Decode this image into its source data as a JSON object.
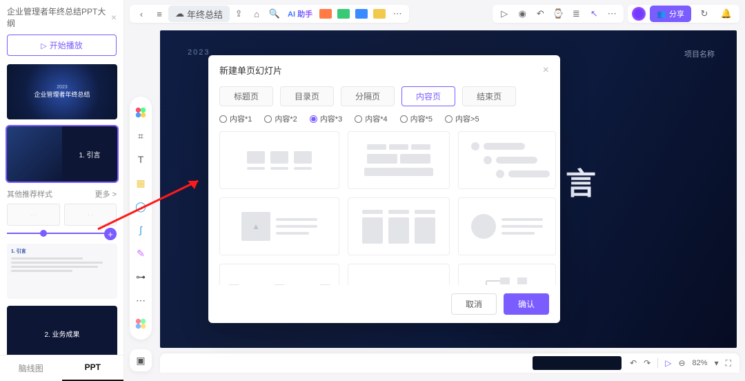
{
  "doc": {
    "title": "企业管理者年终总结PPT大纲",
    "close": "×"
  },
  "play": {
    "icon": "▷",
    "label": "开始播放"
  },
  "slides": {
    "sec1": "1. 引言",
    "other_styles": "其他推荐样式",
    "more": "更多 >",
    "outline_hd": "1. 引言",
    "sec2": "2. 业务成果",
    "cover_title": "企业管理者年终总结"
  },
  "bottom_tabs": {
    "mindmap": "脑线图",
    "ppt": "PPT"
  },
  "rail": {
    "crop": "⌗",
    "text": "T",
    "note": "▦",
    "shape": "◯",
    "curve": "∫",
    "brush": "✎",
    "connector": "⊶",
    "more": "⋯"
  },
  "toolbar": {
    "back": "‹",
    "menu": "≡",
    "cloud": "☁",
    "doc_chip": "年终总结",
    "export": "⇪",
    "tag": "⌂",
    "search": "🔍",
    "ai": "AI 助手",
    "sq_p": "P",
    "sq_g": "⌘",
    "sq_b": "▦",
    "sq_y": "▤",
    "r_play": "▷",
    "r_rec": "◉",
    "r_undo": "↶",
    "r_redo": "⌚",
    "r_chart": "≣",
    "r_cursor": "↖",
    "r_more": "⋯",
    "share_icon": "👥",
    "share": "分享",
    "history": "↻",
    "bell": "🔔"
  },
  "canvas": {
    "year": "2023",
    "project": "项目名称",
    "main": "言"
  },
  "canvas_bar": {
    "undo": "↶",
    "redo": "↷",
    "cursor": "▷",
    "zoom_out": "⊖",
    "zoom": "82%",
    "zoom_in": "▾",
    "full": "⛶"
  },
  "modal": {
    "title": "新建单页幻灯片",
    "close": "×",
    "tabs": {
      "title": "标题页",
      "toc": "目录页",
      "divider": "分隔页",
      "content": "内容页",
      "end": "结束页"
    },
    "radios": {
      "r1": "内容*1",
      "r2": "内容*2",
      "r3": "内容*3",
      "r4": "内容*4",
      "r5": "内容*5",
      "r6": "内容>5"
    },
    "cancel": "取消",
    "ok": "确认"
  }
}
